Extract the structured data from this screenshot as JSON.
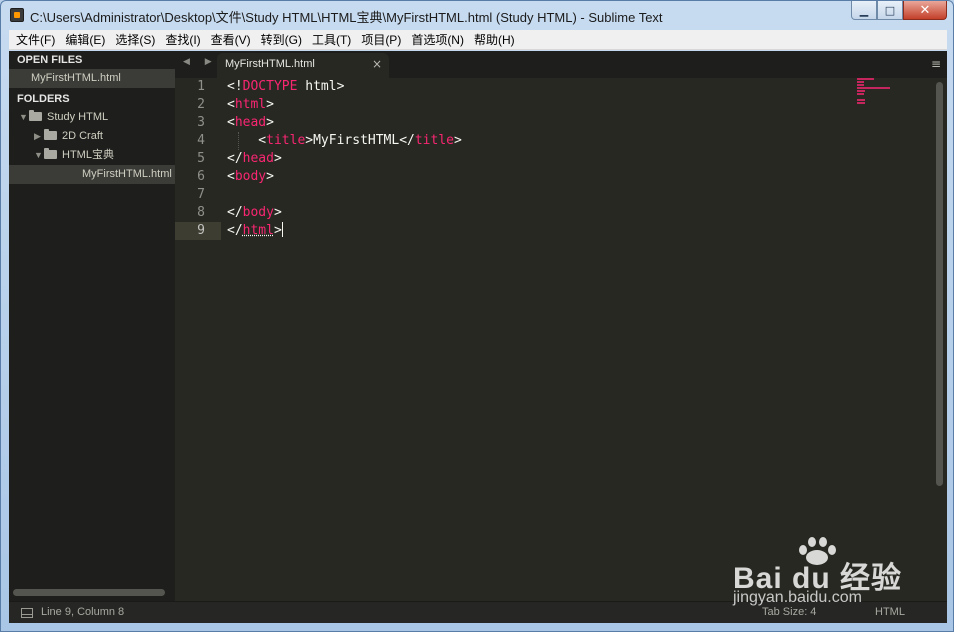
{
  "window": {
    "title": "C:\\Users\\Administrator\\Desktop\\文件\\Study HTML\\HTML宝典\\MyFirstHTML.html (Study HTML) - Sublime Text",
    "minimize_label": "▁",
    "maximize_label": "□",
    "close_label": "✕"
  },
  "menu": [
    "文件(F)",
    "编辑(E)",
    "选择(S)",
    "查找(I)",
    "查看(V)",
    "转到(G)",
    "工具(T)",
    "项目(P)",
    "首选项(N)",
    "帮助(H)"
  ],
  "sidebar": {
    "open_files_header": "OPEN FILES",
    "open_files": [
      "MyFirstHTML.html"
    ],
    "folders_header": "FOLDERS",
    "tree": [
      {
        "label": "Study HTML",
        "arrow": "▼"
      },
      {
        "label": "2D Craft",
        "arrow": "▶"
      },
      {
        "label": "HTML宝典",
        "arrow": "▼"
      },
      {
        "label": "MyFirstHTML.html"
      }
    ]
  },
  "tabs": {
    "nav": "◀ ▶",
    "active_tab": "MyFirstHTML.html",
    "close": "×",
    "menu_icon": "≡"
  },
  "editor": {
    "line_numbers": [
      "1",
      "2",
      "3",
      "4",
      "5",
      "6",
      "7",
      "8",
      "9"
    ],
    "current_line": 9,
    "lines": [
      [
        "<!",
        "DOCTYPE",
        " html>"
      ],
      [
        "<",
        "html",
        ">"
      ],
      [
        "<",
        "head",
        ">"
      ],
      [
        "    <",
        "title",
        ">MyFirstHTML</",
        "title",
        ">"
      ],
      [
        "</",
        "head",
        ">"
      ],
      [
        "<",
        "body",
        ">"
      ],
      [],
      [
        "</",
        "body",
        ">"
      ],
      [
        "</",
        "html",
        ">"
      ]
    ]
  },
  "status": {
    "position": "Line 9, Column 8",
    "tab_size": "Tab Size: 4",
    "syntax": "HTML"
  },
  "watermark": {
    "brand": "Bai du 经验",
    "url": "jingyan.baidu.com"
  },
  "colors": {
    "background": "#272822",
    "tag": "#f92672",
    "text": "#f8f8f2",
    "gutter": "#8f908a",
    "sidebar": "#1e1e1c"
  }
}
